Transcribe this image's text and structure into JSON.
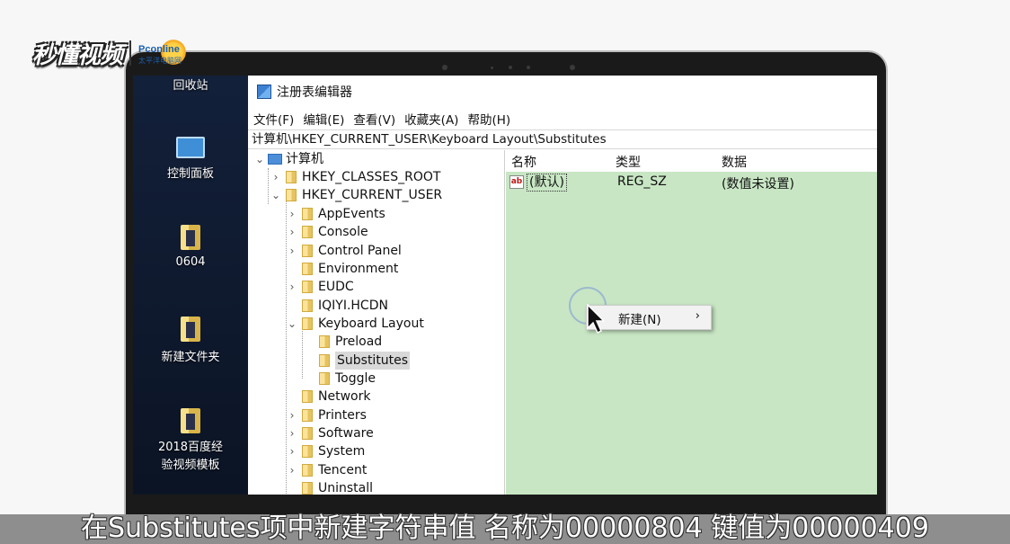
{
  "watermark": {
    "brand": "秒懂视频",
    "pc_brand": "Pconline",
    "pc_sub": "太平洋电脑网"
  },
  "desktop": {
    "icons": [
      {
        "label": "回收站",
        "icon": "recycle-bin-icon"
      },
      {
        "label": "控制面板",
        "icon": "control-panel-icon"
      },
      {
        "label": "0604",
        "icon": "folder-icon"
      },
      {
        "label": "新建文件夹",
        "icon": "folder-icon"
      },
      {
        "label": "2018百度经",
        "label2": "验视频模板",
        "icon": "folder-icon"
      }
    ]
  },
  "regedit": {
    "title": "注册表编辑器",
    "menu": [
      "文件(F)",
      "编辑(E)",
      "查看(V)",
      "收藏夹(A)",
      "帮助(H)"
    ],
    "address": "计算机\\HKEY_CURRENT_USER\\Keyboard Layout\\Substitutes",
    "tree": {
      "root": "计算机",
      "hkcr": "HKEY_CLASSES_ROOT",
      "hkcu": "HKEY_CURRENT_USER",
      "children": [
        "AppEvents",
        "Console",
        "Control Panel",
        "Environment",
        "EUDC",
        "IQIYI.HCDN",
        "Keyboard Layout"
      ],
      "kb_children": [
        "Preload",
        "Substitutes",
        "Toggle"
      ],
      "after": [
        "Network",
        "Printers",
        "Software",
        "System",
        "Tencent",
        "Uninstall"
      ]
    },
    "columns": {
      "name": "名称",
      "type": "类型",
      "data": "数据"
    },
    "values": [
      {
        "name": "(默认)",
        "type": "REG_SZ",
        "data": "(数值未设置)"
      }
    ],
    "context_menu": {
      "new_label": "新建(N)",
      "arrow": "›"
    },
    "colors": {
      "list_bg": "#c8e6c4",
      "selection": "#d9d9d9"
    }
  },
  "subtitle": "在Substitutes项中新建字符串值 名称为00000804 键值为00000409"
}
